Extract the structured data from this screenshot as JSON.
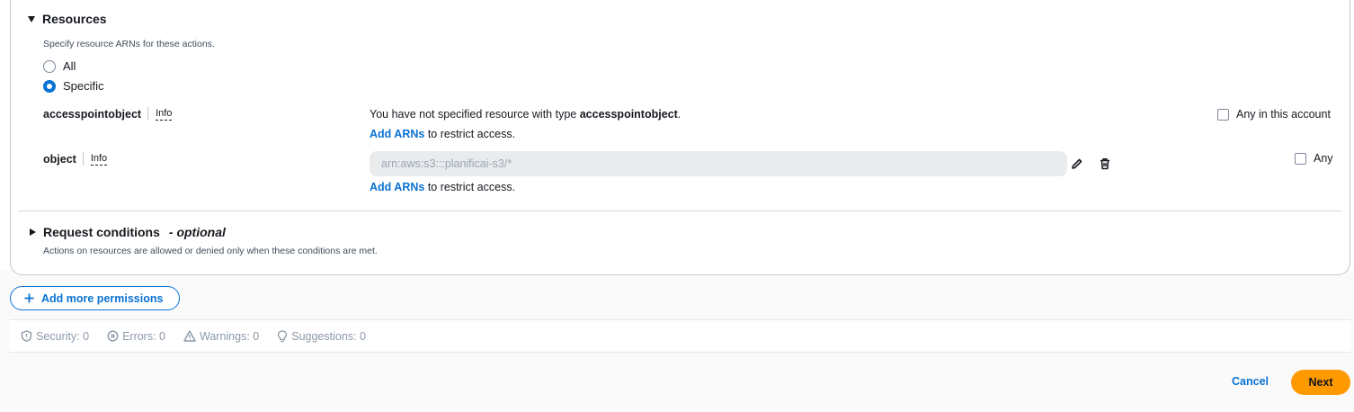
{
  "resources": {
    "title": "Resources",
    "description": "Specify resource ARNs for these actions.",
    "radio_all": "All",
    "radio_specific": "Specific",
    "selected": "Specific",
    "items": [
      {
        "label": "accesspointobject",
        "info": "Info",
        "message_prefix": "You have not specified resource with type ",
        "message_type": "accesspointobject",
        "message_suffix": ".",
        "add_arns": "Add ARNs",
        "restrict": " to restrict access.",
        "any_label": "Any in this account",
        "any_checked": false
      },
      {
        "label": "object",
        "info": "Info",
        "arn_value": "arn:aws:s3:::planificai-s3/*",
        "add_arns": "Add ARNs",
        "restrict": " to restrict access.",
        "any_label": "Any",
        "any_checked": false
      }
    ]
  },
  "request_conditions": {
    "title": "Request conditions",
    "optional": "- optional",
    "description": "Actions on resources are allowed or denied only when these conditions are met."
  },
  "add_more_permissions": "Add more permissions",
  "status": {
    "security": "Security: 0",
    "errors": "Errors: 0",
    "warnings": "Warnings: 0",
    "suggestions": "Suggestions: 0"
  },
  "footer": {
    "cancel": "Cancel",
    "next": "Next"
  },
  "colors": {
    "accent": "#0972d3",
    "primary_button": "#ff9900"
  }
}
